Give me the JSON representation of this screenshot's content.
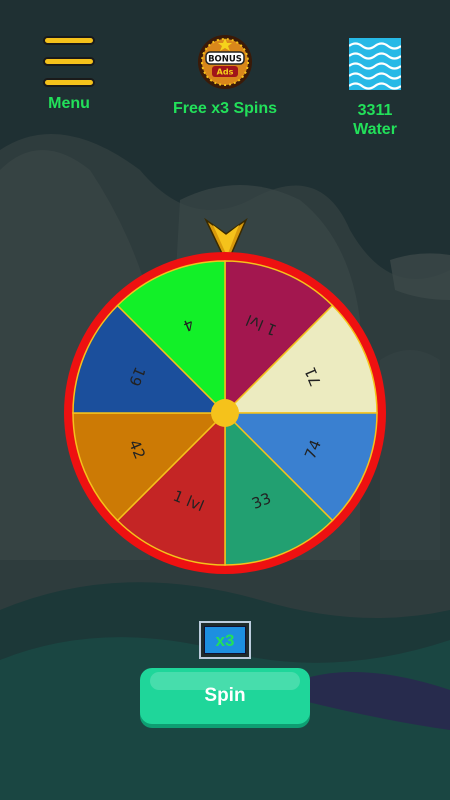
{
  "colors": {
    "accent_green": "#22e05a",
    "menu_yellow": "#f5c21b",
    "wheel_rim": "#ee1111",
    "spin_button": "#1fd69a",
    "hub": "#f5c21b"
  },
  "topbar": {
    "menu": {
      "label": "Menu",
      "icon": "hamburger-menu-icon"
    },
    "bonus": {
      "label": "Free x3 Spins",
      "icon": "bonus-ads-badge-icon",
      "badge_top": "BONUS",
      "badge_bottom": "Ads"
    },
    "water": {
      "value": "3311",
      "label": "Water",
      "icon": "water-waves-icon"
    }
  },
  "wheel": {
    "segments": [
      {
        "label": "1 lvl",
        "color": "#a3174f"
      },
      {
        "label": "71",
        "color": "#ecebc0"
      },
      {
        "label": "74",
        "color": "#3a80d0"
      },
      {
        "label": "33",
        "color": "#22a071"
      },
      {
        "label": "1 lvl",
        "color": "#c42525"
      },
      {
        "label": "42",
        "color": "#cc7a05"
      },
      {
        "label": "19",
        "color": "#1b4f9c"
      },
      {
        "label": "4",
        "color": "#12f028"
      }
    ]
  },
  "multiplier": {
    "label": "x3"
  },
  "spin_button": {
    "label": "Spin"
  }
}
